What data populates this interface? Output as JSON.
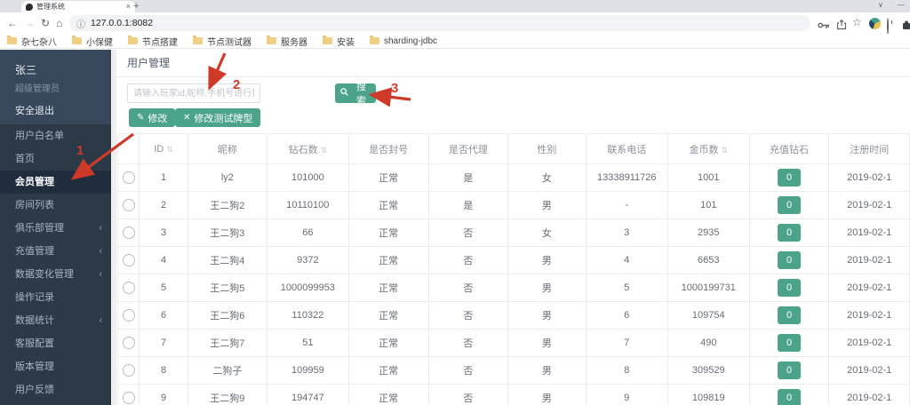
{
  "browser": {
    "tab_title": "管理系统",
    "url": "127.0.0.1:8082",
    "bookmarks": [
      "杂七杂八",
      "小保健",
      "节点搭建",
      "节点测试器",
      "服务器",
      "安装",
      "sharding-jdbc"
    ]
  },
  "icons": {
    "back": "←",
    "forward": "→",
    "reload": "↻",
    "home": "⌂",
    "info": "ⓘ",
    "star": "☆",
    "tab_close": "×",
    "new_tab": "+",
    "tab_search_chevron": "∨",
    "minimize": "—",
    "sort": "⇅",
    "collapse_chevron": "‹",
    "edit": "✎",
    "close": "✕"
  },
  "sidebar": {
    "username": "张三",
    "role": "超级管理员",
    "logout_label": "安全退出",
    "items": [
      {
        "label": "用户白名单",
        "active": false,
        "expandable": false
      },
      {
        "label": "首页",
        "active": false,
        "expandable": false
      },
      {
        "label": "会员管理",
        "active": true,
        "expandable": false
      },
      {
        "label": "房间列表",
        "active": false,
        "expandable": false
      },
      {
        "label": "俱乐部管理",
        "active": false,
        "expandable": true
      },
      {
        "label": "充值管理",
        "active": false,
        "expandable": true
      },
      {
        "label": "数据变化管理",
        "active": false,
        "expandable": true
      },
      {
        "label": "操作记录",
        "active": false,
        "expandable": false
      },
      {
        "label": "数据统计",
        "active": false,
        "expandable": true
      },
      {
        "label": "客服配置",
        "active": false,
        "expandable": false
      },
      {
        "label": "版本管理",
        "active": false,
        "expandable": false
      },
      {
        "label": "用户反馈",
        "active": false,
        "expandable": false
      }
    ]
  },
  "main": {
    "title": "用户管理",
    "search_placeholder": "请输入玩家id,昵称,手机号进行搜索",
    "search_button_label": "搜索",
    "edit_button_label": "修改",
    "edit_type_button_label": "修改测试牌型",
    "table": {
      "headers": [
        {
          "label": "ID",
          "sortable": true
        },
        {
          "label": "昵称",
          "sortable": false
        },
        {
          "label": "钻石数",
          "sortable": true
        },
        {
          "label": "是否封号",
          "sortable": false
        },
        {
          "label": "是否代理",
          "sortable": false
        },
        {
          "label": "性别",
          "sortable": false
        },
        {
          "label": "联系电话",
          "sortable": false
        },
        {
          "label": "金币数",
          "sortable": true
        },
        {
          "label": "充值钻石",
          "sortable": false
        },
        {
          "label": "注册时间",
          "sortable": false
        }
      ],
      "rows": [
        {
          "id": "1",
          "nickname": "ly2",
          "diamonds": "101000",
          "banned": "正常",
          "agent": "是",
          "gender": "女",
          "phone": "13338911726",
          "gold": "1001",
          "recharge": "0",
          "registered": "2019-02-1"
        },
        {
          "id": "2",
          "nickname": "王二狗2",
          "diamonds": "10110100",
          "banned": "正常",
          "agent": "是",
          "gender": "男",
          "phone": "-",
          "gold": "101",
          "recharge": "0",
          "registered": "2019-02-1"
        },
        {
          "id": "3",
          "nickname": "王二狗3",
          "diamonds": "66",
          "banned": "正常",
          "agent": "否",
          "gender": "女",
          "phone": "3",
          "gold": "2935",
          "recharge": "0",
          "registered": "2019-02-1"
        },
        {
          "id": "4",
          "nickname": "王二狗4",
          "diamonds": "9372",
          "banned": "正常",
          "agent": "否",
          "gender": "男",
          "phone": "4",
          "gold": "6653",
          "recharge": "0",
          "registered": "2019-02-1"
        },
        {
          "id": "5",
          "nickname": "王二狗5",
          "diamonds": "1000099953",
          "banned": "正常",
          "agent": "否",
          "gender": "男",
          "phone": "5",
          "gold": "1000199731",
          "recharge": "0",
          "registered": "2019-02-1"
        },
        {
          "id": "6",
          "nickname": "王二狗6",
          "diamonds": "110322",
          "banned": "正常",
          "agent": "否",
          "gender": "男",
          "phone": "6",
          "gold": "109754",
          "recharge": "0",
          "registered": "2019-02-1"
        },
        {
          "id": "7",
          "nickname": "王二狗7",
          "diamonds": "51",
          "banned": "正常",
          "agent": "否",
          "gender": "男",
          "phone": "7",
          "gold": "490",
          "recharge": "0",
          "registered": "2019-02-1"
        },
        {
          "id": "8",
          "nickname": "二狗子",
          "diamonds": "109959",
          "banned": "正常",
          "agent": "否",
          "gender": "男",
          "phone": "8",
          "gold": "309529",
          "recharge": "0",
          "registered": "2019-02-1"
        },
        {
          "id": "9",
          "nickname": "王二狗9",
          "diamonds": "194747",
          "banned": "正常",
          "agent": "否",
          "gender": "男",
          "phone": "9",
          "gold": "109819",
          "recharge": "0",
          "registered": "2019-02-1"
        }
      ]
    }
  },
  "annotations": {
    "steps": [
      "1",
      "2",
      "3"
    ]
  },
  "colors": {
    "accent_green": "#4ba489",
    "annotation_red": "#cf3a28",
    "sidebar_bg": "#2c3947",
    "sidebar_active_bg": "#1f2d3d",
    "sidebar_user_block_bg": "#37485a"
  }
}
